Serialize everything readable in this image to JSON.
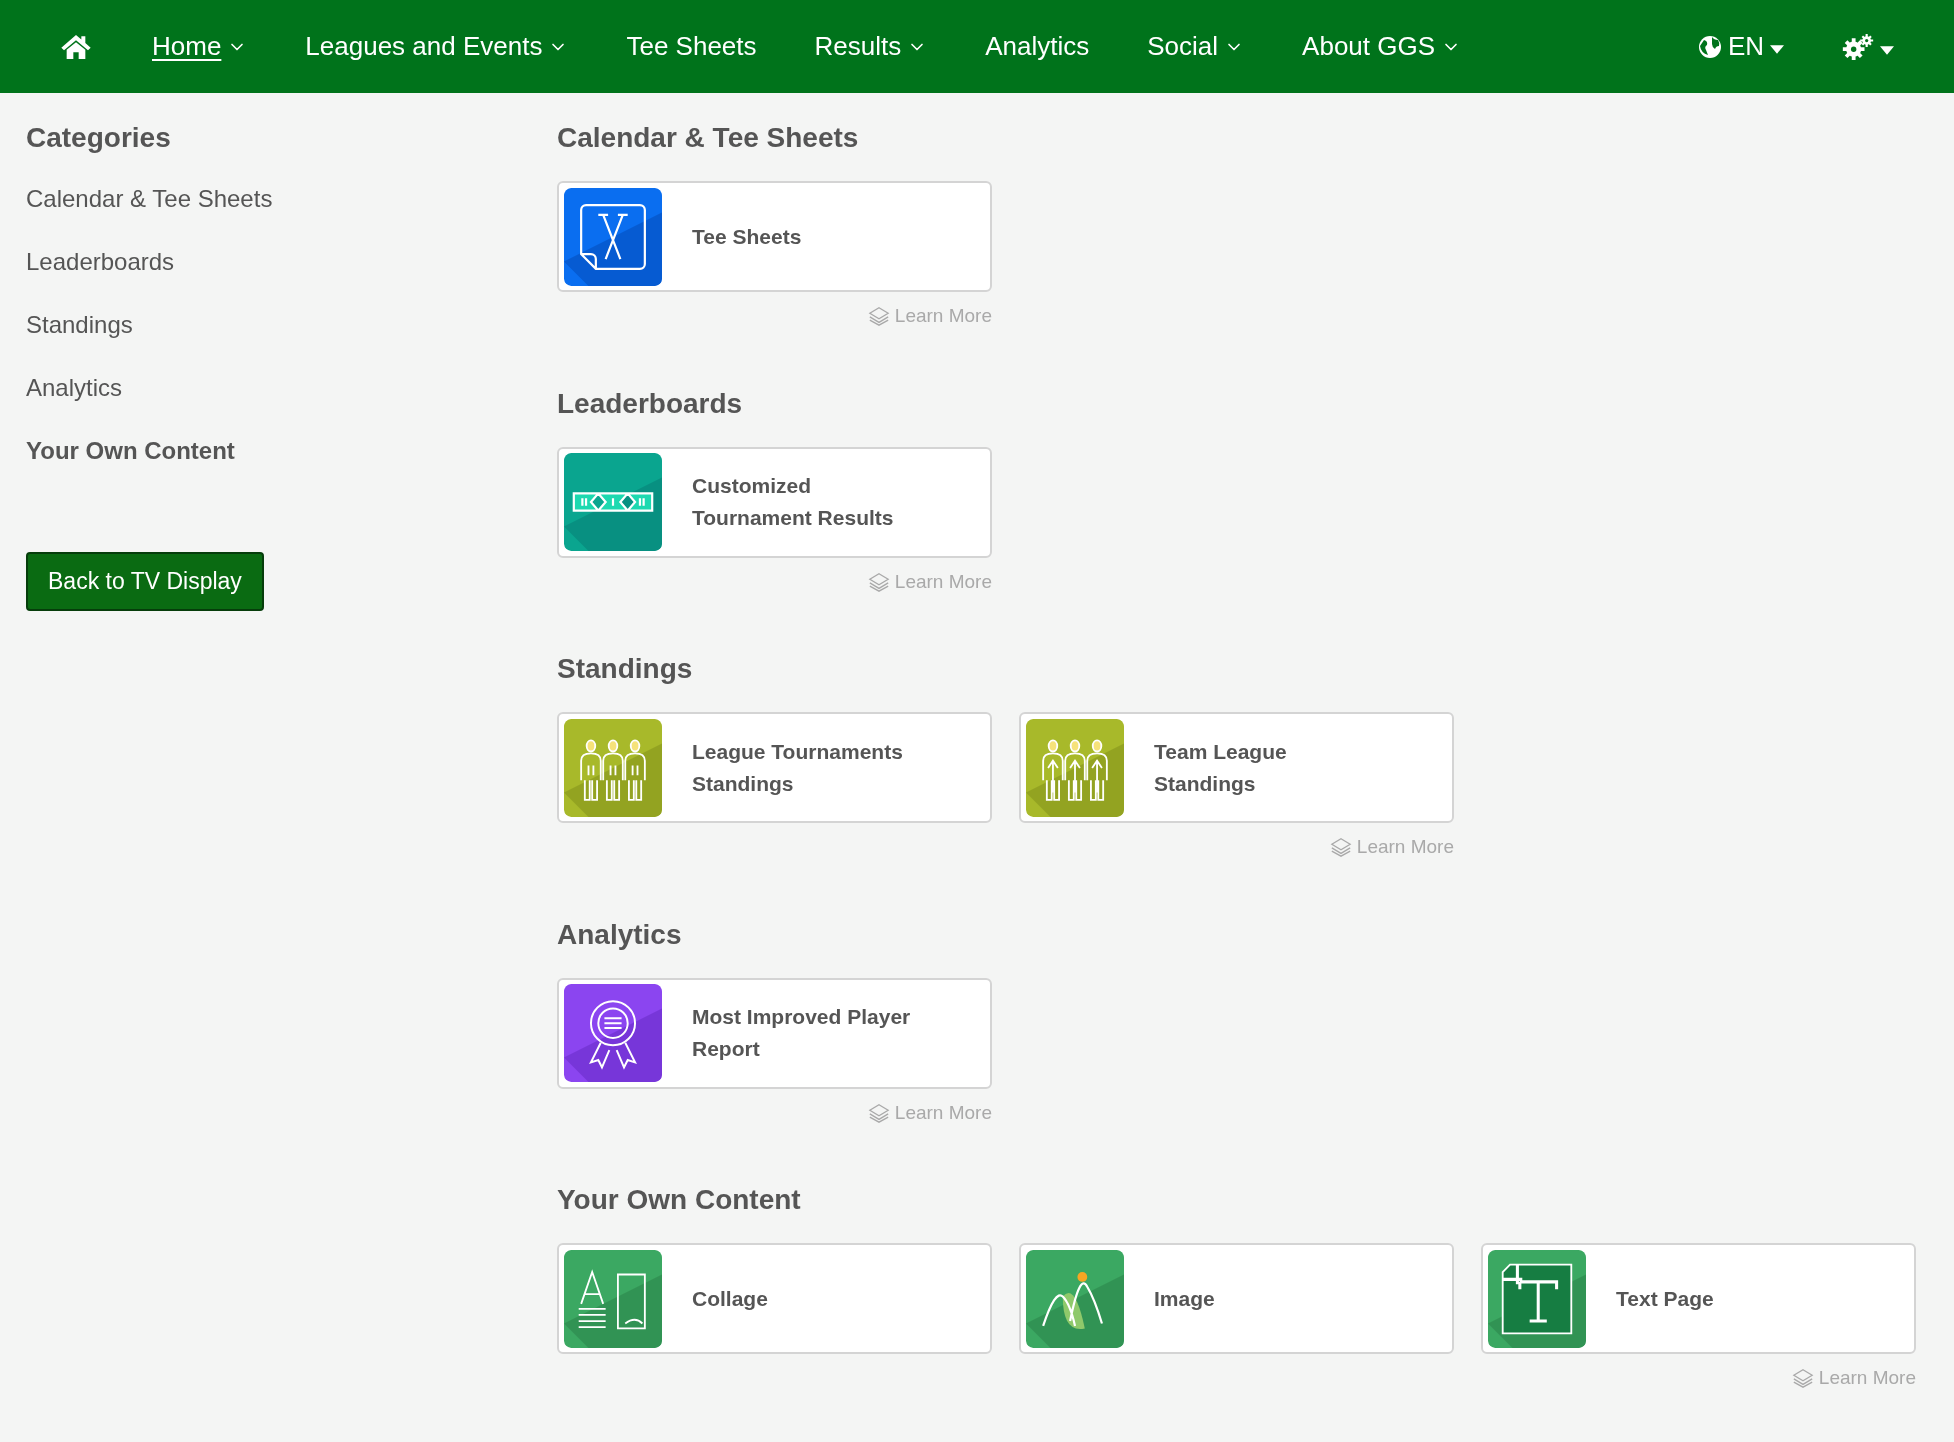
{
  "nav": {
    "items": [
      {
        "label": "Home",
        "selected": true,
        "dropdown": true
      },
      {
        "label": "Leagues and Events",
        "selected": false,
        "dropdown": true
      },
      {
        "label": "Tee Sheets",
        "selected": false,
        "dropdown": false
      },
      {
        "label": "Results",
        "selected": false,
        "dropdown": true
      },
      {
        "label": "Analytics",
        "selected": false,
        "dropdown": false
      },
      {
        "label": "Social",
        "selected": false,
        "dropdown": true
      },
      {
        "label": "About GGS",
        "selected": false,
        "dropdown": true
      }
    ],
    "language": "EN"
  },
  "sidebar": {
    "title": "Categories",
    "items": [
      {
        "label": "Calendar & Tee Sheets",
        "selected": false
      },
      {
        "label": "Leaderboards",
        "selected": false
      },
      {
        "label": "Standings",
        "selected": false
      },
      {
        "label": "Analytics",
        "selected": false
      },
      {
        "label": "Your Own Content",
        "selected": true
      }
    ],
    "button": "Back to TV Display"
  },
  "sections": [
    {
      "title": "Calendar & Tee Sheets",
      "learn_more": "Learn More",
      "tiles": [
        {
          "kind": "tee-sheets",
          "label": "Tee Sheets"
        }
      ]
    },
    {
      "title": "Leaderboards",
      "learn_more": "Learn More",
      "tiles": [
        {
          "kind": "results",
          "label": "Customized Tournament Results"
        }
      ]
    },
    {
      "title": "Standings",
      "learn_more": "Learn More",
      "tiles": [
        {
          "kind": "standings",
          "label": "League Tournaments Standings"
        },
        {
          "kind": "team-standings",
          "label": "Team League Standings"
        }
      ]
    },
    {
      "title": "Analytics",
      "learn_more": "Learn More",
      "tiles": [
        {
          "kind": "award",
          "label": "Most Improved Player Report"
        }
      ]
    },
    {
      "title": "Your Own Content",
      "learn_more": "Learn More",
      "tiles": [
        {
          "kind": "collage",
          "label": "Collage"
        },
        {
          "kind": "image",
          "label": "Image"
        },
        {
          "kind": "text-page",
          "label": "Text Page"
        }
      ]
    }
  ]
}
